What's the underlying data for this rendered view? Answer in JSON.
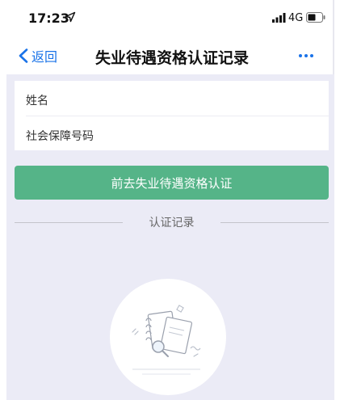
{
  "status_bar": {
    "time": "17:23",
    "network": "4G",
    "icons": [
      "location-arrow-icon",
      "signal-bars-icon",
      "battery-icon"
    ]
  },
  "nav": {
    "back_label": "返回",
    "title": "失业待遇资格认证记录",
    "icons": [
      "chevron-left-icon",
      "more-icon"
    ]
  },
  "info_card": {
    "name_label": "姓名",
    "id_label": "社会保障号码"
  },
  "primary_button": {
    "label": "前去失业待遇资格认证",
    "color": "#55b488"
  },
  "records_section": {
    "title": "认证记录",
    "empty_illustration_icon": "notebook-magnifier-illustration"
  },
  "colors": {
    "accent": "#1a73e8",
    "content_background": "#ebebf6"
  }
}
